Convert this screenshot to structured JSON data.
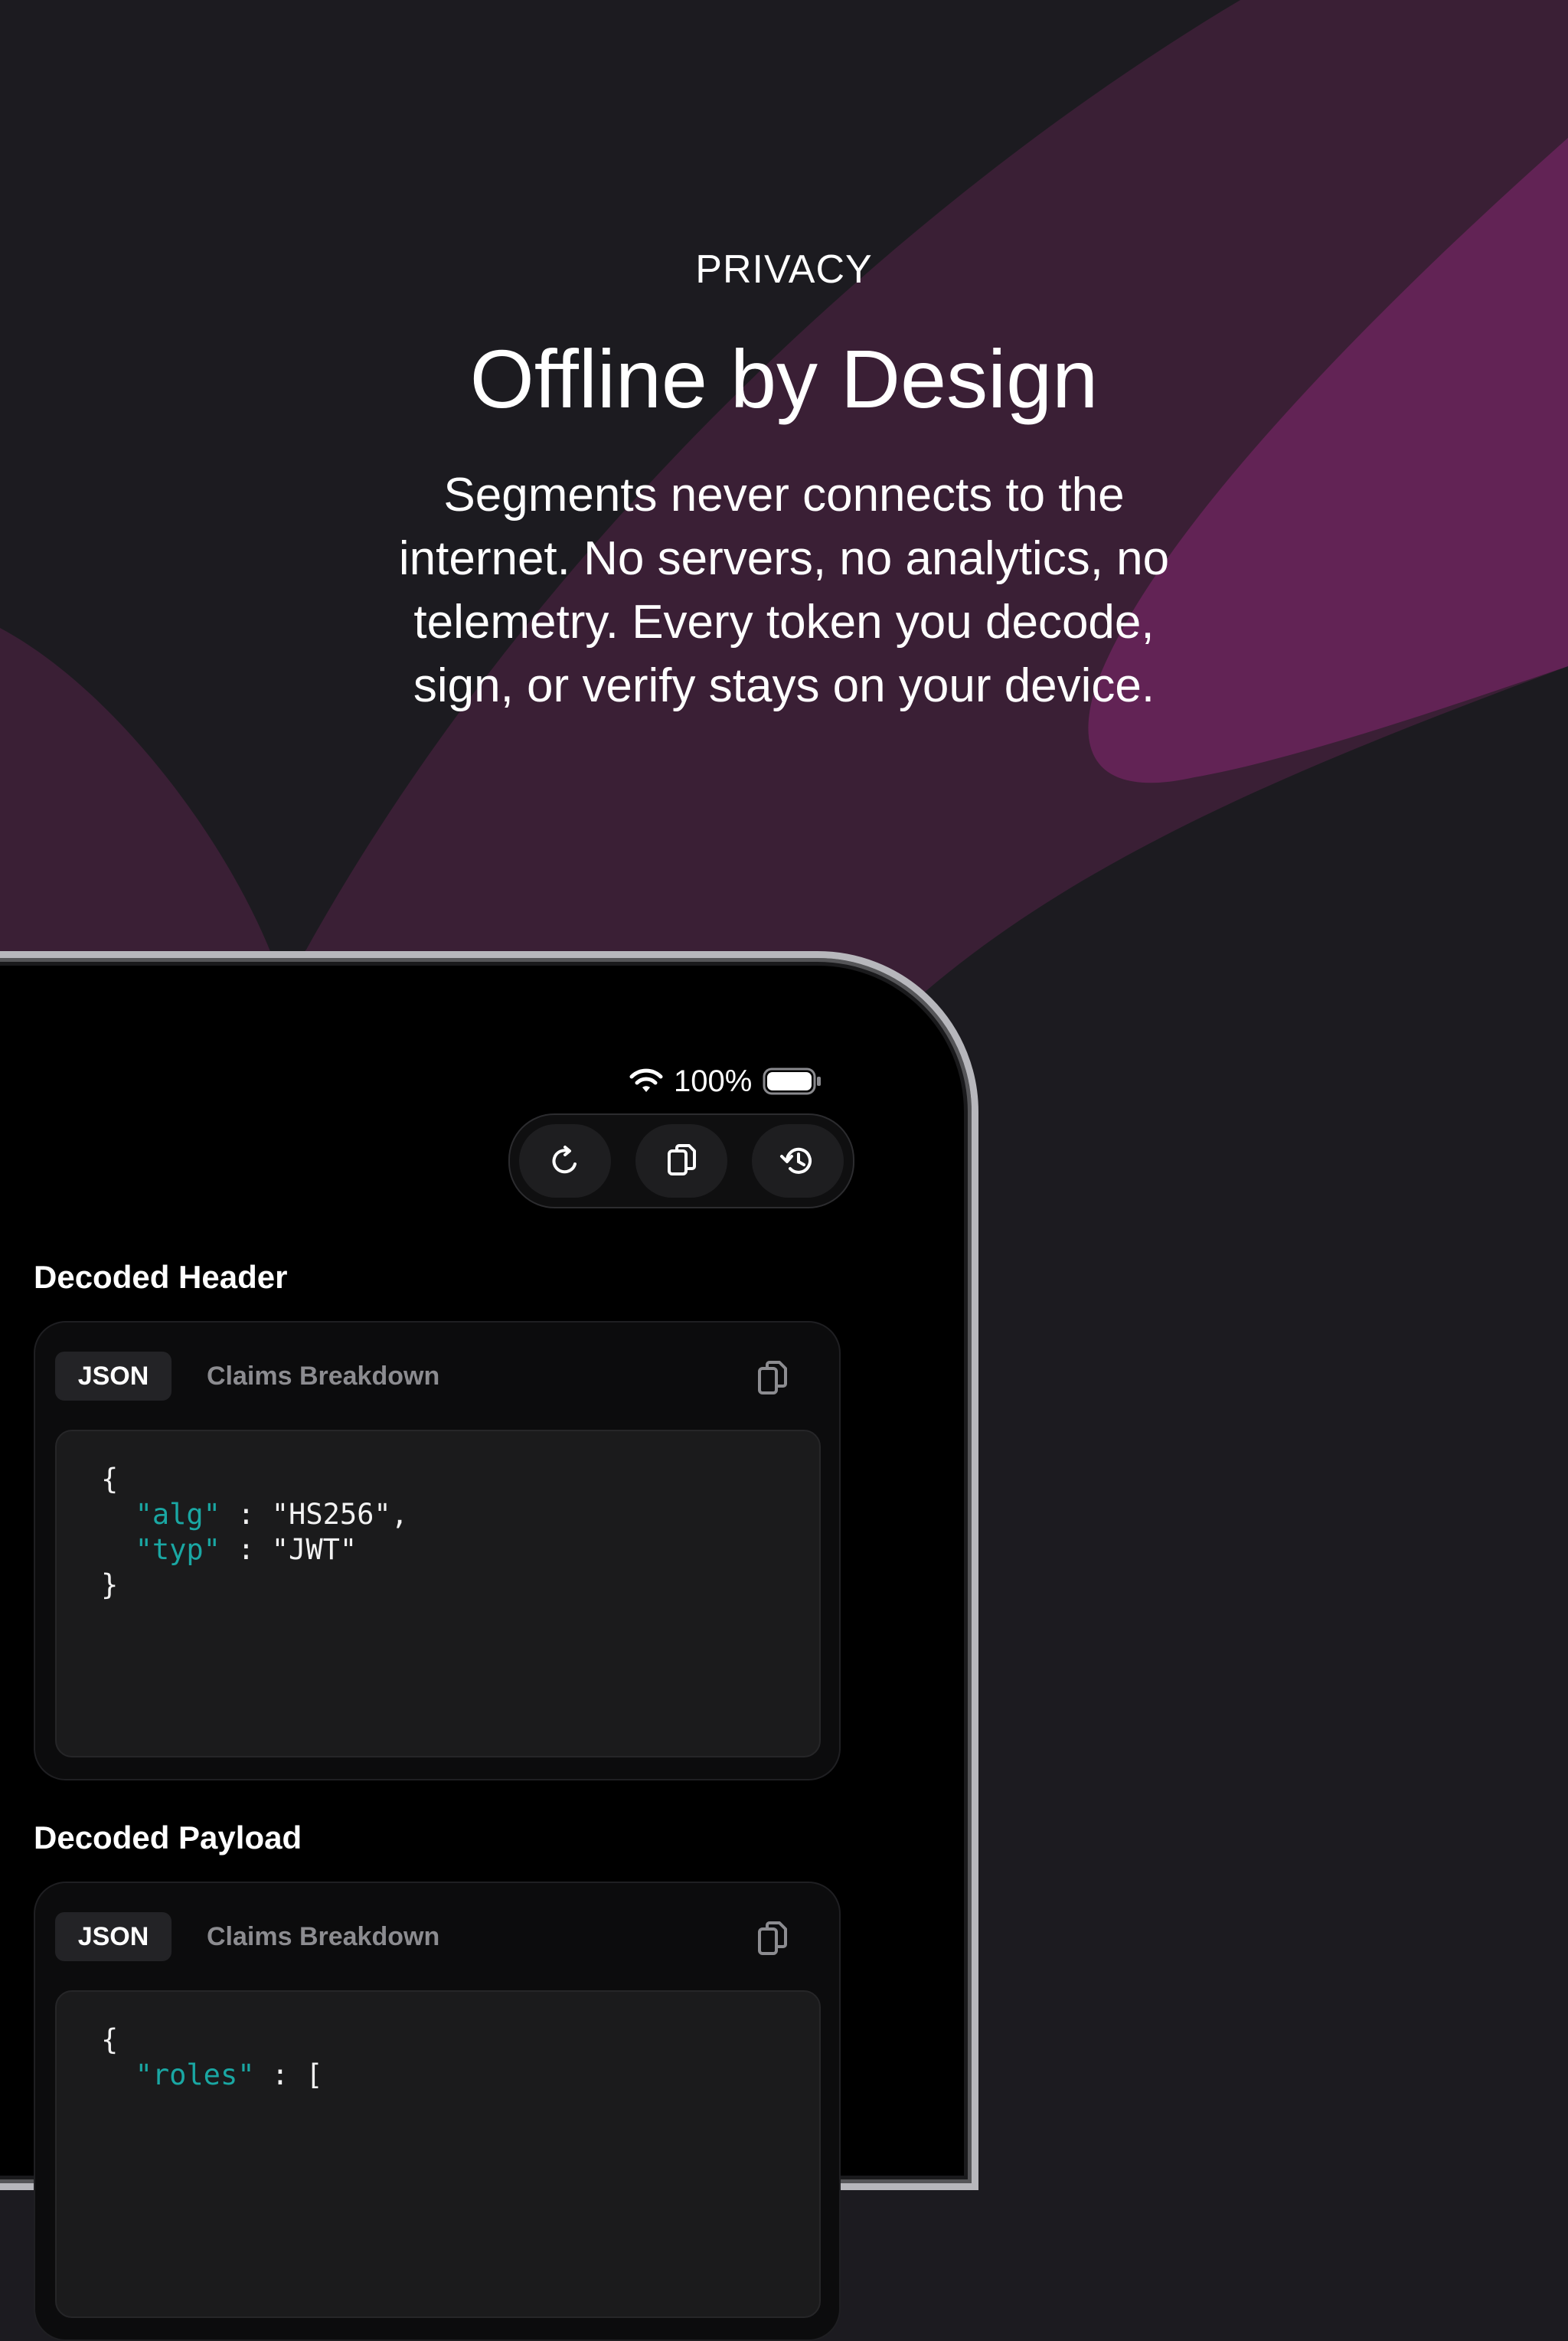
{
  "hero": {
    "eyebrow": "PRIVACY",
    "headline": "Offline by Design",
    "body": "Segments never connects to the internet. No servers, no analytics, no telemetry. Every token you decode, sign, or verify stays on your device."
  },
  "status_bar": {
    "battery_text": "100%",
    "icons": [
      "wifi-icon",
      "battery-icon"
    ]
  },
  "toolbar": {
    "buttons": [
      "refresh-icon",
      "copy-icon",
      "history-icon"
    ]
  },
  "header_section": {
    "title": "Decoded Header",
    "tabs": {
      "json": "JSON",
      "claims": "Claims Breakdown",
      "selected": "JSON"
    },
    "code": {
      "open": "{",
      "lines": [
        {
          "key": "\"alg\"",
          "sep": " : ",
          "value": "\"HS256\","
        },
        {
          "key": "\"typ\"",
          "sep": " : ",
          "value": "\"JWT\""
        }
      ],
      "close": "}"
    }
  },
  "payload_section": {
    "title": "Decoded Payload",
    "tabs": {
      "json": "JSON",
      "claims": "Claims Breakdown",
      "selected": "JSON"
    },
    "code": {
      "open": "{",
      "lines": [
        {
          "key": "\"roles\"",
          "sep": " : ",
          "value": "["
        }
      ]
    }
  },
  "colors": {
    "background": "#1c1b20",
    "wave_dark": "#3a1f35",
    "wave_light": "#622355",
    "json_key": "#1aa7a3"
  }
}
